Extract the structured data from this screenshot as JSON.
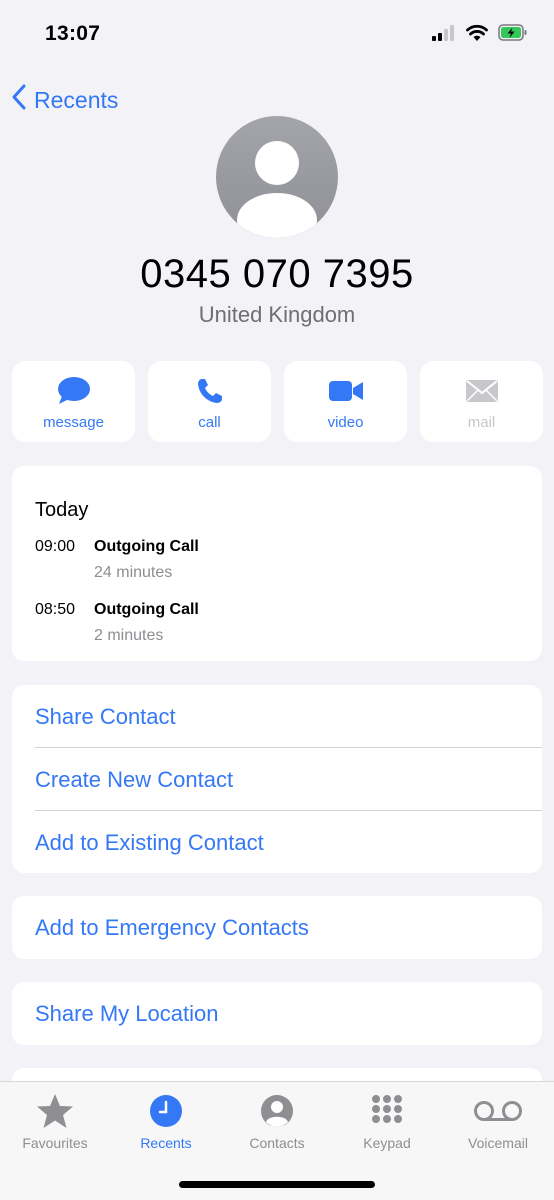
{
  "status_bar": {
    "time": "13:07",
    "signal_icon": "cellular-signal-icon",
    "wifi_icon": "wifi-icon",
    "battery_icon": "battery-charging-icon"
  },
  "nav": {
    "back_label": "Recents"
  },
  "contact": {
    "number": "0345 070 7395",
    "country": "United Kingdom"
  },
  "actions": [
    {
      "label": "message",
      "icon": "message-icon",
      "enabled": true
    },
    {
      "label": "call",
      "icon": "phone-icon",
      "enabled": true
    },
    {
      "label": "video",
      "icon": "video-icon",
      "enabled": true
    },
    {
      "label": "mail",
      "icon": "mail-icon",
      "enabled": false
    }
  ],
  "history": {
    "title": "Today",
    "calls": [
      {
        "time": "09:00",
        "type": "Outgoing Call",
        "duration": "24 minutes"
      },
      {
        "time": "08:50",
        "type": "Outgoing Call",
        "duration": "2 minutes"
      }
    ]
  },
  "contact_options": [
    "Share Contact",
    "Create New Contact",
    "Add to Existing Contact"
  ],
  "emergency_option": "Add to Emergency Contacts",
  "location_option": "Share My Location",
  "tabs": [
    {
      "label": "Favourites",
      "icon": "star-icon",
      "active": false
    },
    {
      "label": "Recents",
      "icon": "clock-icon",
      "active": true
    },
    {
      "label": "Contacts",
      "icon": "person-circle-icon",
      "active": false
    },
    {
      "label": "Keypad",
      "icon": "keypad-icon",
      "active": false
    },
    {
      "label": "Voicemail",
      "icon": "voicemail-icon",
      "active": false
    }
  ],
  "colors": {
    "accent": "#3478f6",
    "background": "#f2f2f7",
    "secondary_text": "#8e8e93",
    "battery": "#34c759"
  }
}
